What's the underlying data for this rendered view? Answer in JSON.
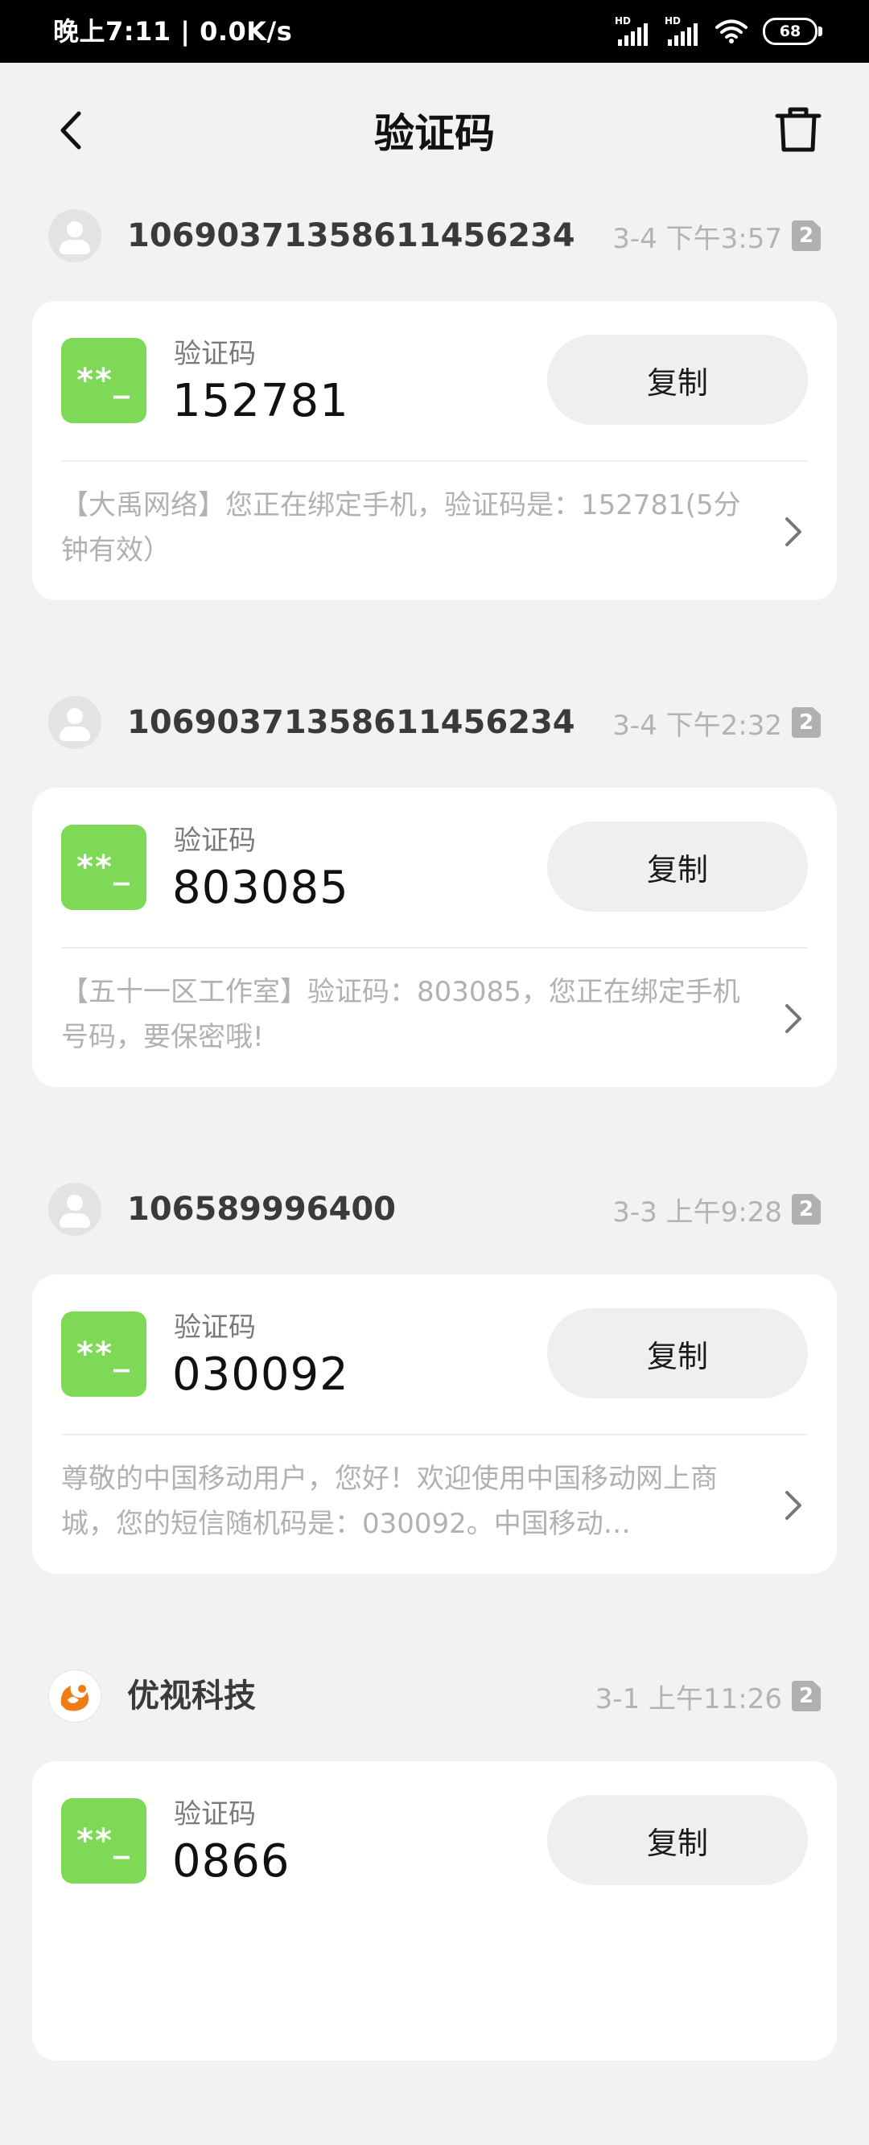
{
  "status_bar": {
    "time_speed": "晚上7:11 | 0.0K/s",
    "battery": "68",
    "hd": "HD"
  },
  "header": {
    "title": "验证码",
    "back_icon": "chevron-left-icon",
    "delete_icon": "trash-icon"
  },
  "messages": [
    {
      "sender": "10690371358611456234",
      "date": "3-4 下午3:57",
      "sim": "2",
      "code_label": "验证码",
      "code": "152781",
      "icon_text": "**_",
      "copy_label": "复制",
      "preview": "【大禹网络】您正在绑定手机，验证码是：152781(5分钟有效）"
    },
    {
      "sender": "10690371358611456234",
      "date": "3-4 下午2:32",
      "sim": "2",
      "code_label": "验证码",
      "code": "803085",
      "icon_text": "**_",
      "copy_label": "复制",
      "preview": "【五十一区工作室】验证码：803085，您正在绑定手机号码，要保密哦!"
    },
    {
      "sender": "106589996400",
      "date": "3-3 上午9:28",
      "sim": "2",
      "code_label": "验证码",
      "code": "030092",
      "icon_text": "**_",
      "copy_label": "复制",
      "preview": "尊敬的中国移动用户，您好！欢迎使用中国移动网上商城，您的短信随机码是：030092。中国移动…"
    },
    {
      "sender": "优视科技",
      "date": "3-1 上午11:26",
      "sim": "2",
      "code_label": "验证码",
      "code": "0866",
      "icon_text": "**_",
      "copy_label": "复制",
      "preview": ""
    }
  ],
  "colors": {
    "accent_green": "#7ed957",
    "background": "#f2f2f4"
  }
}
